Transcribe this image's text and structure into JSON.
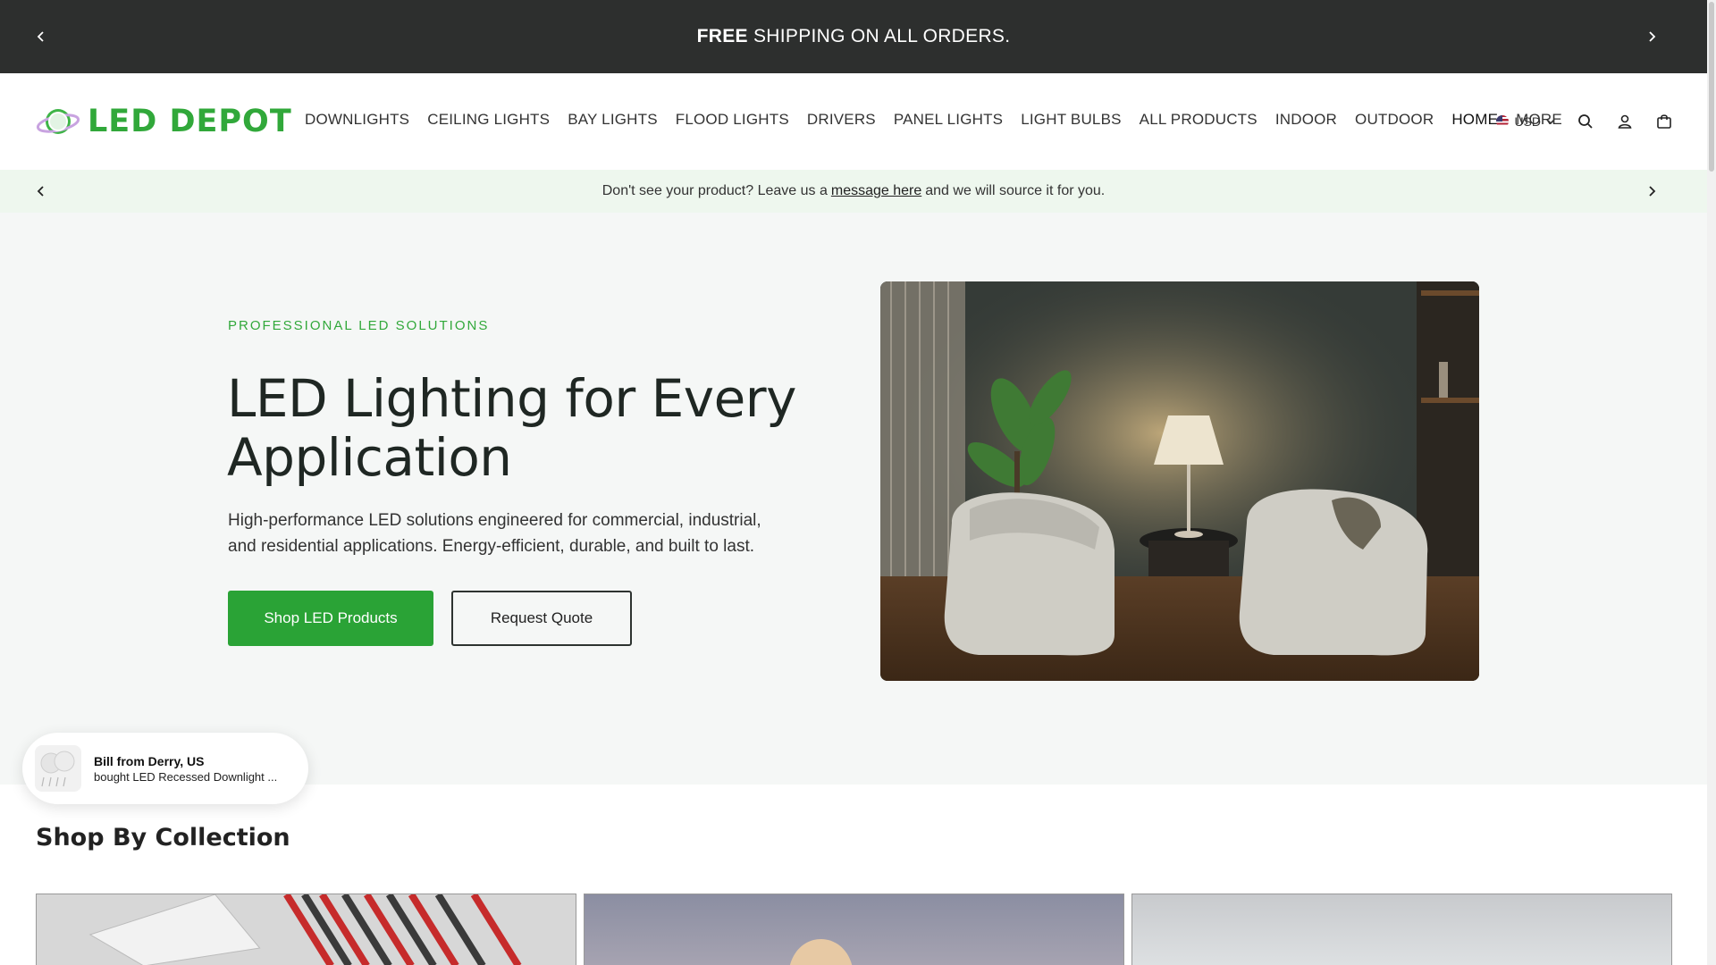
{
  "announcement": {
    "bold": "FREE",
    "rest": " SHIPPING ON ALL ORDERS."
  },
  "header": {
    "logo_text": "LED DEPOT",
    "nav": [
      {
        "label": "DOWNLIGHTS"
      },
      {
        "label": "CEILING LIGHTS"
      },
      {
        "label": "BAY LIGHTS"
      },
      {
        "label": "FLOOD LIGHTS"
      },
      {
        "label": "DRIVERS"
      },
      {
        "label": "PANEL LIGHTS"
      },
      {
        "label": "LIGHT BULBS"
      },
      {
        "label": "ALL PRODUCTS"
      },
      {
        "label": "INDOOR"
      },
      {
        "label": "OUTDOOR"
      },
      {
        "label": "HOME"
      },
      {
        "label": "MORE"
      }
    ],
    "currency": "USD"
  },
  "source_bar": {
    "before": "Don't see your product? Leave us a",
    "link": "message here",
    "after": "and we will source it for you."
  },
  "hero": {
    "eyebrow": "PROFESSIONAL LED SOLUTIONS",
    "title": "LED Lighting for Every Application",
    "description": "High-performance LED solutions engineered for commercial, industrial, and residential applications. Energy-efficient, durable, and built to last.",
    "primary_button": "Shop LED Products",
    "secondary_button": "Request Quote"
  },
  "toast": {
    "name": "Bill from Derry, US",
    "action": "bought LED Recessed Downlight ..."
  },
  "collection": {
    "title": "Shop By Collection"
  },
  "colors": {
    "brand_green": "#31a83a",
    "announcement_bg": "#2d2f2e",
    "source_bar_bg": "#eef7ee"
  }
}
